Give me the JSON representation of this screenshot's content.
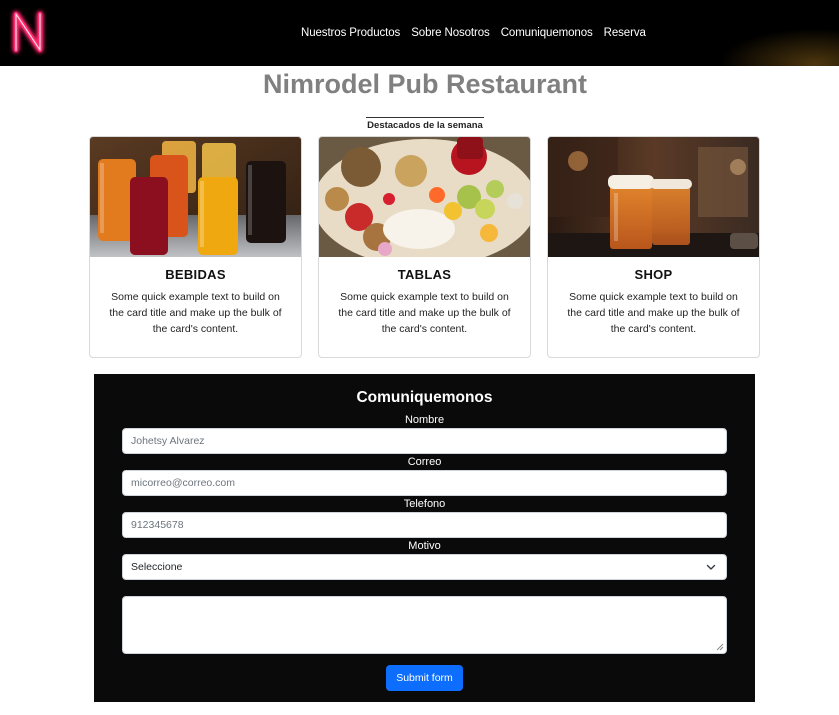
{
  "navbar": {
    "logo_letter": "N",
    "links": [
      {
        "label": "Nuestros Productos"
      },
      {
        "label": "Sobre Nosotros"
      },
      {
        "label": "Comuniquemonos"
      },
      {
        "label": "Reserva"
      }
    ]
  },
  "header": {
    "title": "Nimrodel Pub Restaurant",
    "featured_label": "Destacados de la semana"
  },
  "cards": [
    {
      "title": "BEBIDAS",
      "text": "Some quick example text to build on the card title and make up the bulk of the card's content.",
      "image": "drinks-photo"
    },
    {
      "title": "TABLAS",
      "text": "Some quick example text to build on the card title and make up the bulk of the card's content.",
      "image": "food-board-photo"
    },
    {
      "title": "SHOP",
      "text": "Some quick example text to build on the card title and make up the bulk of the card's content.",
      "image": "beer-glasses-photo"
    }
  ],
  "contact_form": {
    "title": "Comuniquemonos",
    "fields": {
      "name": {
        "label": "Nombre",
        "placeholder": "Johetsy Alvarez"
      },
      "email": {
        "label": "Correo",
        "placeholder": "micorreo@correo.com"
      },
      "phone": {
        "label": "Telefono",
        "placeholder": "912345678"
      },
      "reason": {
        "label": "Motivo",
        "selected": "Seleccione"
      }
    },
    "message_placeholder": "",
    "submit_label": "Submit form"
  },
  "colors": {
    "navbar_bg": "#000000",
    "neon_logo": "#ff2a6d",
    "title_gray": "#808080",
    "form_bg": "#0a0a0a",
    "button_blue": "#0d6efd"
  }
}
